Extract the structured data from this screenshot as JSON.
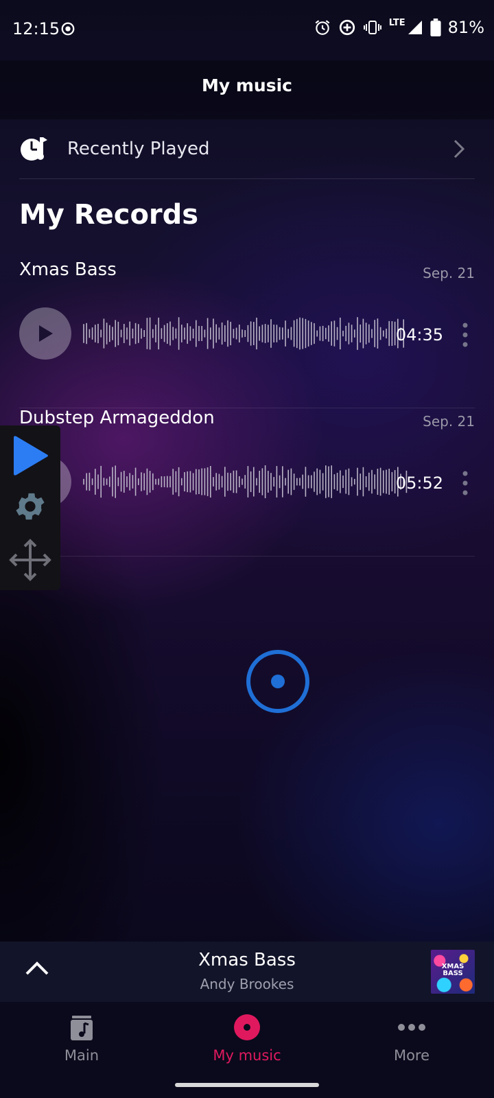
{
  "status_bar": {
    "time": "12:15",
    "network": "LTE",
    "battery": "81%"
  },
  "header": {
    "title": "My music"
  },
  "recently_played": {
    "label": "Recently Played"
  },
  "records": {
    "title": "My Records",
    "items": [
      {
        "name": "Xmas Bass",
        "date": "Sep. 21",
        "duration": "04:35"
      },
      {
        "name": "Dubstep Armageddon",
        "date": "Sep. 21",
        "duration": "05:52"
      }
    ]
  },
  "mini_player": {
    "title": "Xmas Bass",
    "artist": "Andy Brookes",
    "art_text": "XMAS BASS"
  },
  "bottom_nav": {
    "tabs": [
      {
        "label": "Main",
        "icon": "music-note-icon"
      },
      {
        "label": "My music",
        "icon": "disc-icon",
        "active": true
      },
      {
        "label": "More",
        "icon": "more-dots-icon"
      }
    ]
  },
  "colors": {
    "accent": "#e0195e",
    "loader": "#1f6fd6",
    "float_play": "#2c7df3"
  }
}
